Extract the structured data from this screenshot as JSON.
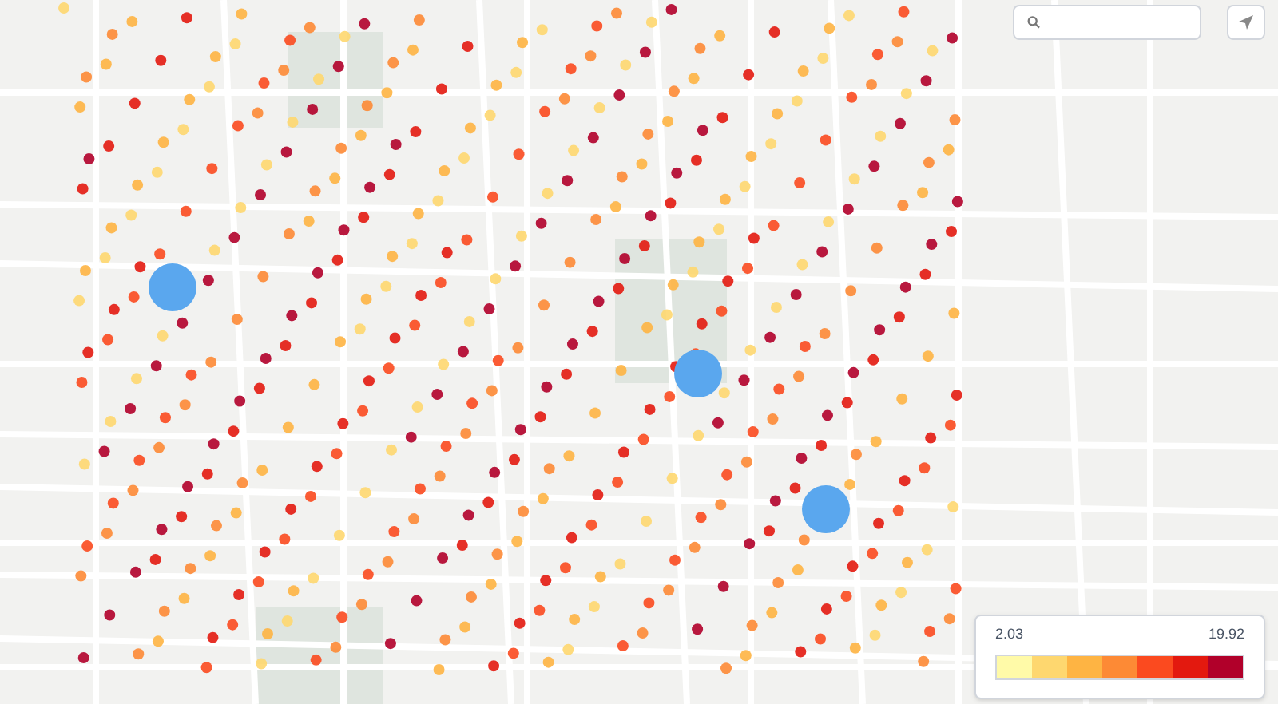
{
  "legend": {
    "min": "2.03",
    "max": "19.92",
    "steps": [
      {
        "color": "#fffaa8"
      },
      {
        "color": "#fed76f"
      },
      {
        "color": "#feb443"
      },
      {
        "color": "#fd8a35"
      },
      {
        "color": "#fb4a1f"
      },
      {
        "color": "#e3190f"
      },
      {
        "color": "#b1002a"
      }
    ]
  }
}
